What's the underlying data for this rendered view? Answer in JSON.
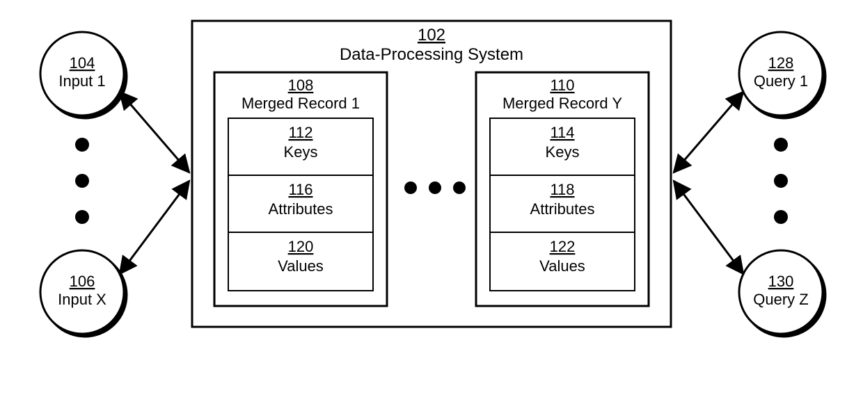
{
  "system": {
    "num": "102",
    "label": "Data-Processing System"
  },
  "left": {
    "top": {
      "num": "104",
      "label": "Input 1"
    },
    "bottom": {
      "num": "106",
      "label": "Input X"
    }
  },
  "right": {
    "top": {
      "num": "128",
      "label": "Query 1"
    },
    "bottom": {
      "num": "130",
      "label": "Query Z"
    }
  },
  "records": {
    "left": {
      "num": "108",
      "label": "Merged Record 1",
      "rows": {
        "keys": {
          "num": "112",
          "label": "Keys"
        },
        "attrs": {
          "num": "116",
          "label": "Attributes"
        },
        "vals": {
          "num": "120",
          "label": "Values"
        }
      }
    },
    "right": {
      "num": "110",
      "label": "Merged Record Y",
      "rows": {
        "keys": {
          "num": "114",
          "label": "Keys"
        },
        "attrs": {
          "num": "118",
          "label": "Attributes"
        },
        "vals": {
          "num": "122",
          "label": "Values"
        }
      }
    }
  }
}
